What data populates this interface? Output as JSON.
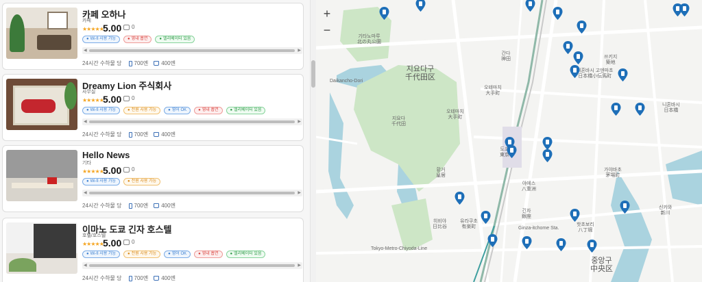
{
  "listings": [
    {
      "title": "카페 오하나",
      "category": "카페",
      "stars": "★★★★★",
      "score": "5.00",
      "comments": "0",
      "tags": [
        {
          "label": "Wi-fi 사용 가능",
          "icon": "wifi-icon",
          "style": "t-blue"
        },
        {
          "label": "영내 흡연",
          "icon": "smoking-icon",
          "style": "t-red"
        },
        {
          "label": "엘리베이터 있음",
          "icon": "elevator-icon",
          "style": "t-green"
        }
      ],
      "hours": "24시간 수하물 당",
      "price_small": "700엔",
      "price_large": "400엔"
    },
    {
      "title": "Dreamy Lion 주식회사",
      "category": "사무실",
      "stars": "★★★★★",
      "score": "5.00",
      "comments": "0",
      "tags": [
        {
          "label": "Wi-fi 사용 가능",
          "icon": "wifi-icon",
          "style": "t-blue"
        },
        {
          "label": "전원 사용 가능",
          "icon": "power-icon",
          "style": "t-orange"
        },
        {
          "label": "영어 OK",
          "icon": "chat-icon",
          "style": "t-blue"
        },
        {
          "label": "영내 흡연",
          "icon": "smoking-icon",
          "style": "t-red"
        },
        {
          "label": "엘리베이터 있음",
          "icon": "elevator-icon",
          "style": "t-green"
        }
      ],
      "hours": "24시간 수하물 당",
      "price_small": "700엔",
      "price_large": "400엔"
    },
    {
      "title": "Hello News",
      "category": "기타",
      "stars": "★★★★★",
      "score": "5.00",
      "comments": "0",
      "tags": [
        {
          "label": "Wi-fi 사용 가능",
          "icon": "wifi-icon",
          "style": "t-blue"
        },
        {
          "label": "전원 사용 가능",
          "icon": "power-icon",
          "style": "t-orange"
        }
      ],
      "hours": "24시간 수하물 당",
      "price_small": "700엔",
      "price_large": "400엔"
    },
    {
      "title": "이마노 도쿄 긴자 호스텔",
      "category": "호텔/호스텔",
      "stars": "★★★★★",
      "score": "5.00",
      "comments": "0",
      "tags": [
        {
          "label": "Wi-fi 사용 가능",
          "icon": "wifi-icon",
          "style": "t-blue"
        },
        {
          "label": "전원 사용 가능",
          "icon": "power-icon",
          "style": "t-orange"
        },
        {
          "label": "영어 OK",
          "icon": "chat-icon",
          "style": "t-blue"
        },
        {
          "label": "영내 흡연",
          "icon": "smoking-icon",
          "style": "t-red"
        },
        {
          "label": "엘리베이터 있음",
          "icon": "elevator-icon",
          "style": "t-green"
        }
      ],
      "hours": "24시간 수하물 당",
      "price_small": "700엔",
      "price_large": "400엔"
    }
  ],
  "map": {
    "zoom_in": "+",
    "zoom_out": "−",
    "labels": [
      "지요다구\n千代田区",
      "지요다\n千代田",
      "중앙구\n中央区",
      "황거\n皇居",
      "간다\n神田",
      "오테마치\n大手町",
      "니혼바시\n日本橋",
      "도쿄\n東京",
      "야에스\n八重洲",
      "긴자\n銀座",
      "핫초보리\n八丁堀",
      "쓰키지\n築地",
      "유라쿠초\n有楽町",
      "히비야\n日比谷",
      "Ginza-itchome Sta.",
      "Daikancho-Dori",
      "Tokyo-Metro-Chiyoda-Line",
      "가야바초\n茅場町",
      "신카와\n新川",
      "기타노마루\n北の丸公園",
      "니혼바시 고덴마초\n日本橋小伝馬町",
      "오테마치\n大手町"
    ]
  },
  "colors": {
    "pin": "#1e6fb8",
    "park": "#cde6c6",
    "water": "#aad3df",
    "rail": "#8fb8a8"
  }
}
